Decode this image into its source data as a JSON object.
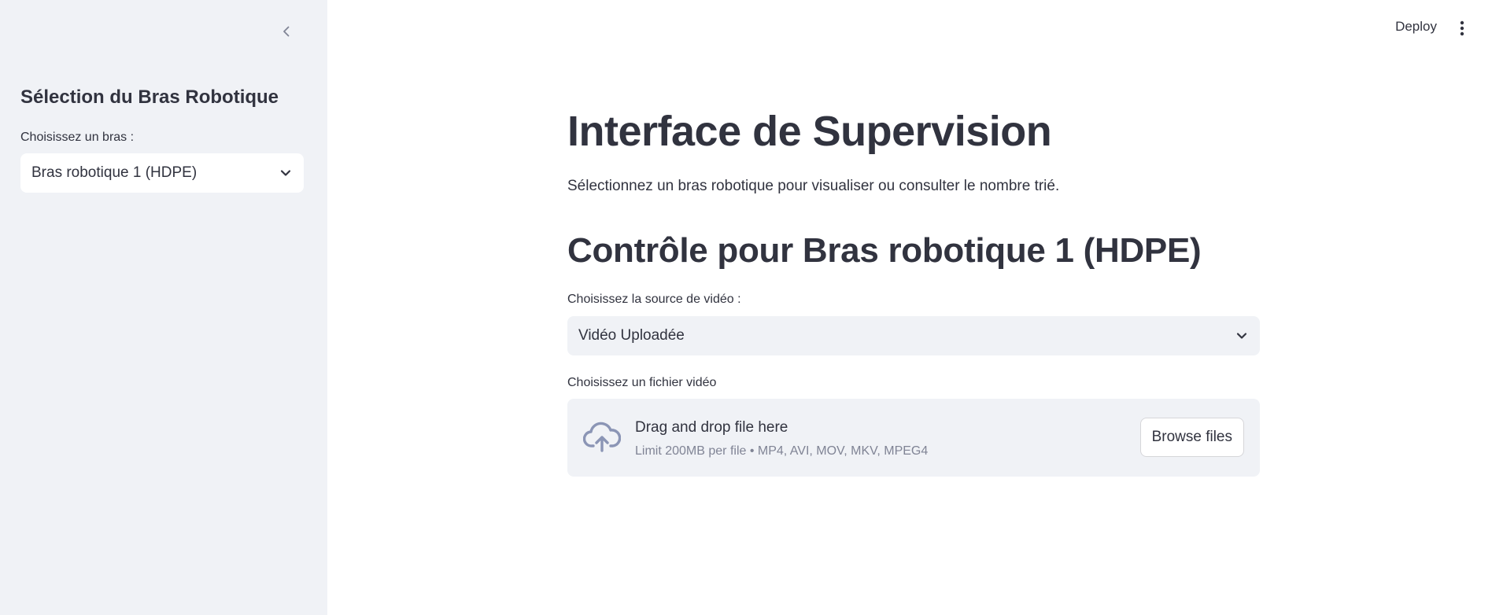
{
  "header": {
    "deploy_label": "Deploy"
  },
  "sidebar": {
    "title": "Sélection du Bras Robotique",
    "select_label": "Choisissez un bras :",
    "select_value": "Bras robotique 1 (HDPE)"
  },
  "main": {
    "title": "Interface de Supervision",
    "description": "Sélectionnez un bras robotique pour visualiser ou consulter le nombre trié.",
    "section_title": "Contrôle pour Bras robotique 1 (HDPE)",
    "video_source_label": "Choisissez la source de vidéo :",
    "video_source_value": "Vidéo Uploadée",
    "file_label": "Choisissez un fichier vidéo",
    "uploader": {
      "drop_text": "Drag and drop file here",
      "limit_text": "Limit 200MB per file • MP4, AVI, MOV, MKV, MPEG4",
      "browse_label": "Browse files"
    }
  },
  "icons": {
    "collapse": "chevron-left-icon",
    "menu": "more-vertical-icon",
    "dropdown": "chevron-down-icon",
    "upload": "cloud-upload-icon"
  },
  "colors": {
    "sidebar_bg": "#f0f2f6",
    "text": "#31333f",
    "muted_text": "#808495",
    "icon": "#8b95b5"
  }
}
